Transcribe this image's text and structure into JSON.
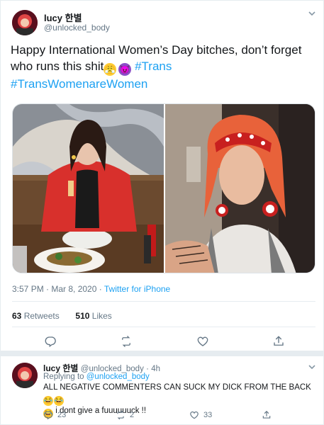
{
  "tweet": {
    "author_name": "lucy 한별",
    "author_handle": "@unlocked_body",
    "text_main": "Happy International Women’s Day bitches, don’t forget who runs this shit",
    "emoji_1": "😤",
    "emoji_2": "😈",
    "hashtag_1": "#Trans",
    "hashtag_2": "#TransWomenareWomen",
    "timestamp": "3:57 PM · Mar 8, 2020",
    "source": "Twitter for iPhone",
    "retweets_count": "63",
    "retweets_label": "Retweets",
    "likes_count": "510",
    "likes_label": "Likes"
  },
  "reply": {
    "author_name": "lucy 한별",
    "author_handle": "@unlocked_body",
    "time": "· 4h",
    "replying_to_label": "Replying to",
    "replying_to_handle": "@unlocked_body",
    "text_line1": "ALL NEGATIVE COMMENTERS CAN SUCK MY DICK FROM THE BACK",
    "emoji_laugh": "😂",
    "text_line2": "i dont give a fuuuuuuck !!",
    "reply_count": "23",
    "retweet_count": "2",
    "like_count": "33"
  },
  "colors": {
    "accent": "#1da1f2",
    "secondary_text": "#657786",
    "border": "#e6ecf0"
  }
}
